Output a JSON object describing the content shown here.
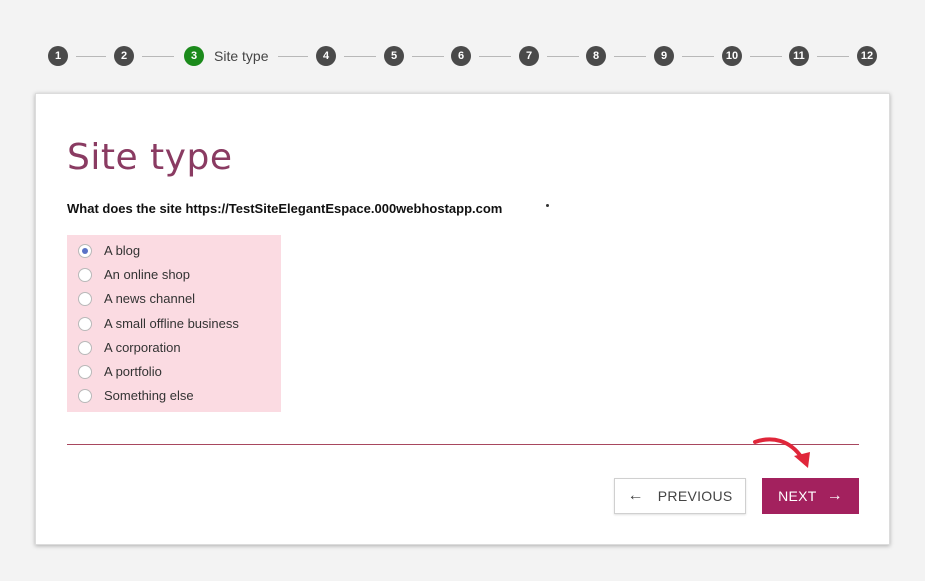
{
  "stepper": {
    "steps": [
      "1",
      "2",
      "3",
      "4",
      "5",
      "6",
      "7",
      "8",
      "9",
      "10",
      "11",
      "12"
    ],
    "active_step": "3",
    "active_title": "Site type",
    "active_color": "#1b8a1b"
  },
  "card": {
    "title": "Site type",
    "question": "What does the site https://TestSiteElegantEspace.000webhostapp.com",
    "options": [
      {
        "label": "A blog",
        "selected": true
      },
      {
        "label": "An online shop",
        "selected": false
      },
      {
        "label": "A news channel",
        "selected": false
      },
      {
        "label": "A small offline business",
        "selected": false
      },
      {
        "label": "A corporation",
        "selected": false
      },
      {
        "label": "A portfolio",
        "selected": false
      },
      {
        "label": "Something else",
        "selected": false
      }
    ],
    "highlight_color": "#fbdbe2",
    "accent_color": "#a3215e"
  },
  "buttons": {
    "previous_label": "PREVIOUS",
    "previous_icon": "arrow-left-icon",
    "next_label": "NEXT",
    "next_icon": "arrow-right-icon"
  },
  "annotation": {
    "icon": "red-curved-arrow-icon",
    "color": "#e0263a"
  }
}
